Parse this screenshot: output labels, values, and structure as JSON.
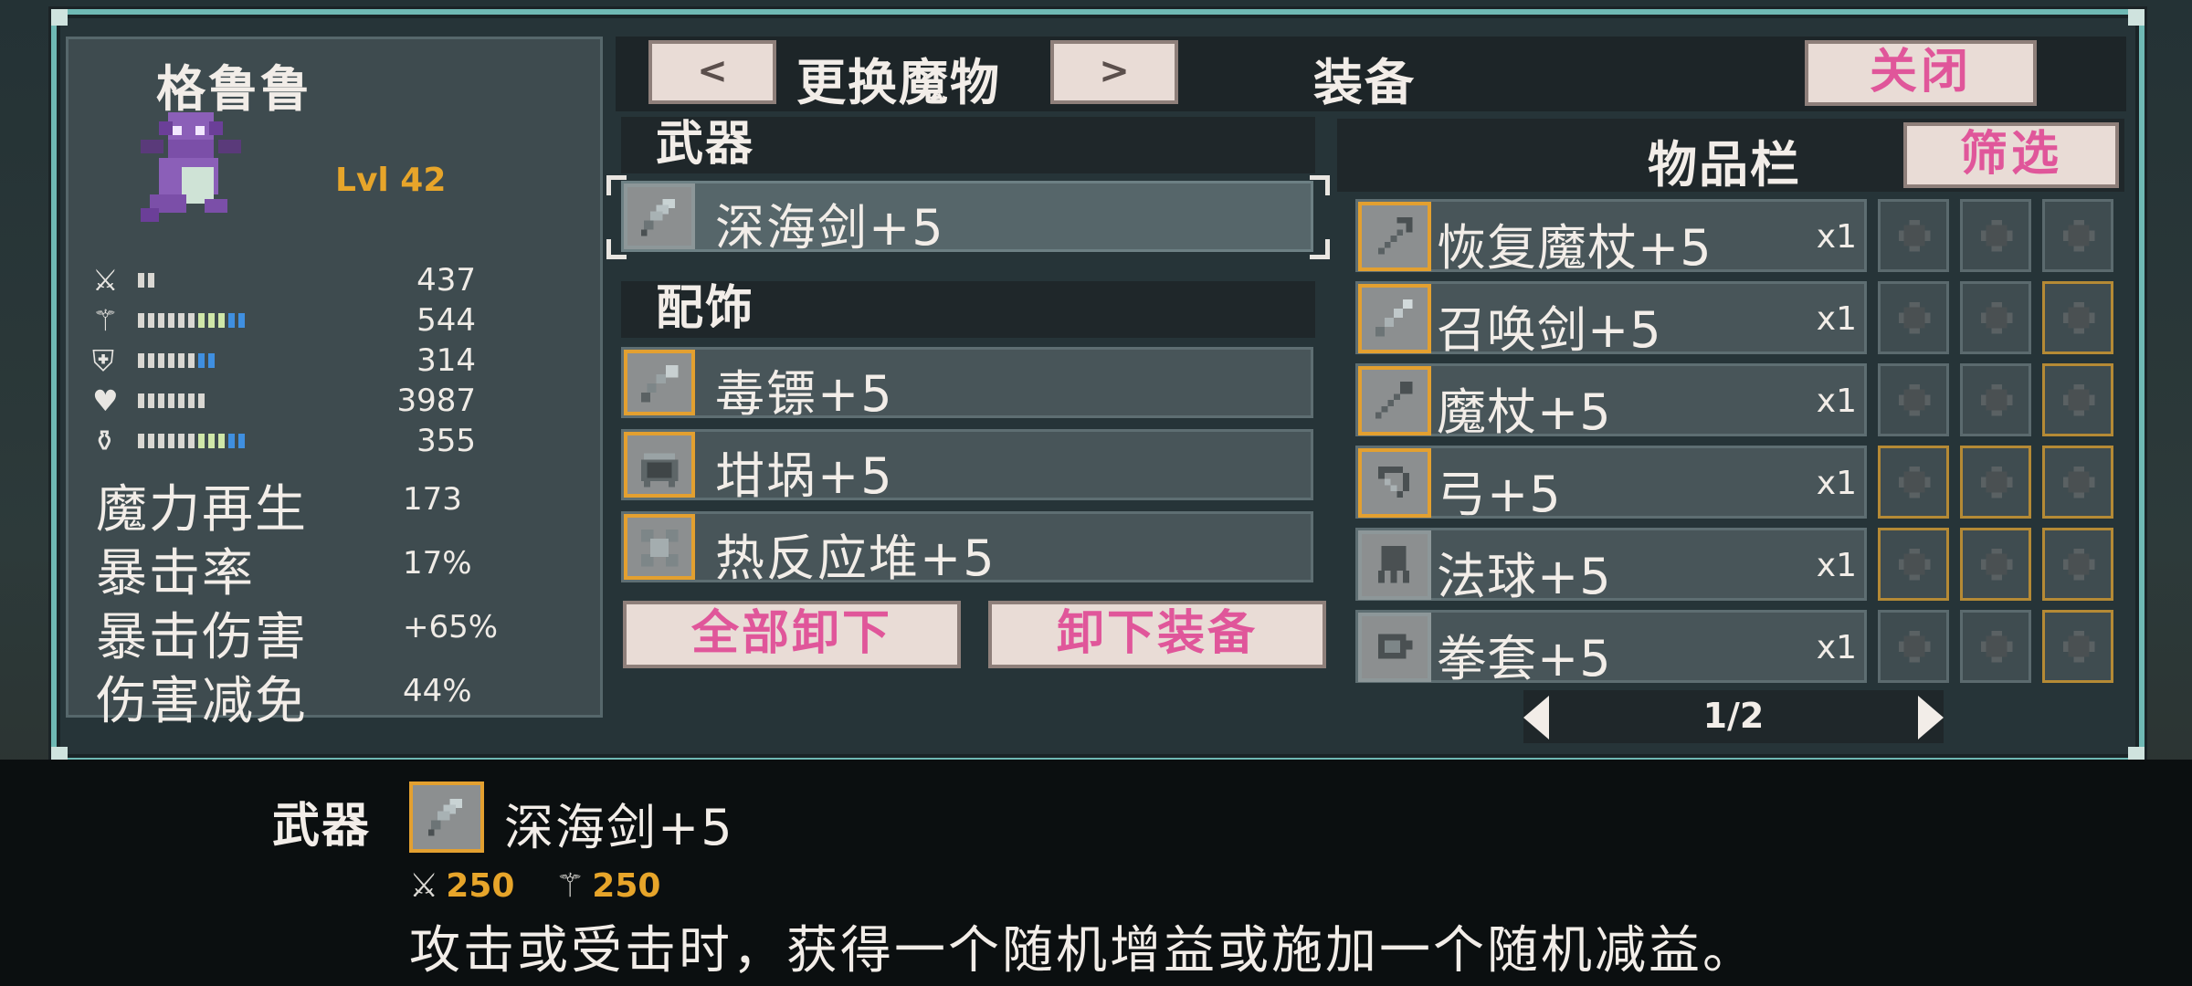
{
  "monster": {
    "name": "格鲁鲁",
    "level": "Lvl 42",
    "sprite_color": "#8b5fb8",
    "stats": [
      {
        "icon": "sword-icon",
        "glyph": "⚔",
        "value": "437",
        "pips": "ww"
      },
      {
        "icon": "wand-icon",
        "glyph": "⚚",
        "value": "544",
        "pips": "wwwwwwgggbb"
      },
      {
        "icon": "shield-icon",
        "glyph": "⛨",
        "value": "314",
        "pips": "wwwwwwbb"
      },
      {
        "icon": "heart-icon",
        "glyph": "♥",
        "value": "3987",
        "pips": "wwwwwww"
      },
      {
        "icon": "potion-icon",
        "glyph": "⚱",
        "value": "355",
        "pips": "wwwwwwgggbb"
      }
    ],
    "derived": [
      {
        "label": "魔力再生",
        "value": "173"
      },
      {
        "label": "暴击率",
        "value": "17%"
      },
      {
        "label": "暴击伤害",
        "value": "+65%"
      },
      {
        "label": "伤害减免",
        "value": "44%"
      }
    ]
  },
  "header": {
    "prev_label": "<",
    "change_label": "更换魔物",
    "next_label": ">",
    "equipment_title": "装备",
    "close_label": "关闭"
  },
  "equipment": {
    "weapon_header": "武器",
    "weapon": {
      "icon": "blade-icon",
      "label": "深海剑+5"
    },
    "accessory_header": "配饰",
    "accessories": [
      {
        "icon": "dart-icon",
        "label": "毒镖+5"
      },
      {
        "icon": "cauldron-icon",
        "label": "坩埚+5"
      },
      {
        "icon": "reactor-icon",
        "label": "热反应堆+5"
      }
    ],
    "unequip_all_label": "全部卸下",
    "unequip_label": "卸下装备"
  },
  "inventory": {
    "title": "物品栏",
    "filter_label": "筛选",
    "items": [
      {
        "icon": "healing-staff-icon",
        "label": "恢复魔杖+5",
        "qty": "x1",
        "border": "gold"
      },
      {
        "icon": "summon-sword-icon",
        "label": "召唤剑+5",
        "qty": "x1",
        "border": "gold"
      },
      {
        "icon": "staff-icon",
        "label": "魔杖+5",
        "qty": "x1",
        "border": "gold"
      },
      {
        "icon": "bow-icon",
        "label": "弓+5",
        "qty": "x1",
        "border": "gold"
      },
      {
        "icon": "orb-icon",
        "label": "法球+5",
        "qty": "x1",
        "border": "grey"
      },
      {
        "icon": "gauntlet-icon",
        "label": "拳套+5",
        "qty": "x1",
        "border": "grey"
      }
    ],
    "grid": [
      [
        {
          "icon": "claw-icon",
          "border": "grey"
        },
        {
          "icon": "shuriken-icon",
          "border": "grey"
        },
        {
          "icon": "spear-icon",
          "border": "grey"
        }
      ],
      [
        {
          "icon": "mace-icon",
          "border": "grey"
        },
        {
          "icon": "bomb-icon",
          "border": "grey"
        },
        {
          "icon": "katana-icon",
          "border": "gold"
        }
      ],
      [
        {
          "icon": "totem-icon",
          "border": "grey"
        },
        {
          "icon": "shield-icon",
          "border": "grey"
        },
        {
          "icon": "dagger-icon",
          "border": "gold"
        }
      ],
      [
        {
          "icon": "harp-icon",
          "border": "gold"
        },
        {
          "icon": "scepter-icon",
          "border": "gold"
        },
        {
          "icon": "branch-icon",
          "border": "gold"
        }
      ],
      [
        {
          "icon": "torch-icon",
          "border": "gold"
        },
        {
          "icon": "rapier-icon",
          "border": "gold"
        },
        {
          "icon": "lyre-icon",
          "border": "gold"
        }
      ],
      [
        {
          "icon": "totem-icon",
          "border": "grey"
        },
        {
          "icon": "fist-icon",
          "border": "grey"
        },
        {
          "icon": "lute-icon",
          "border": "gold"
        }
      ]
    ],
    "page": "1/2"
  },
  "tooltip": {
    "category": "武器",
    "icon": "blade-icon",
    "name": "深海剑+5",
    "attack_stat": "250",
    "magic_stat": "250",
    "description": "攻击或受击时，获得一个随机增益或施加一个随机减益。"
  },
  "colors": {
    "accent_gold": "#e3a030",
    "button_pink_text": "#e0569a",
    "frame_teal": "#6fb9b4"
  }
}
